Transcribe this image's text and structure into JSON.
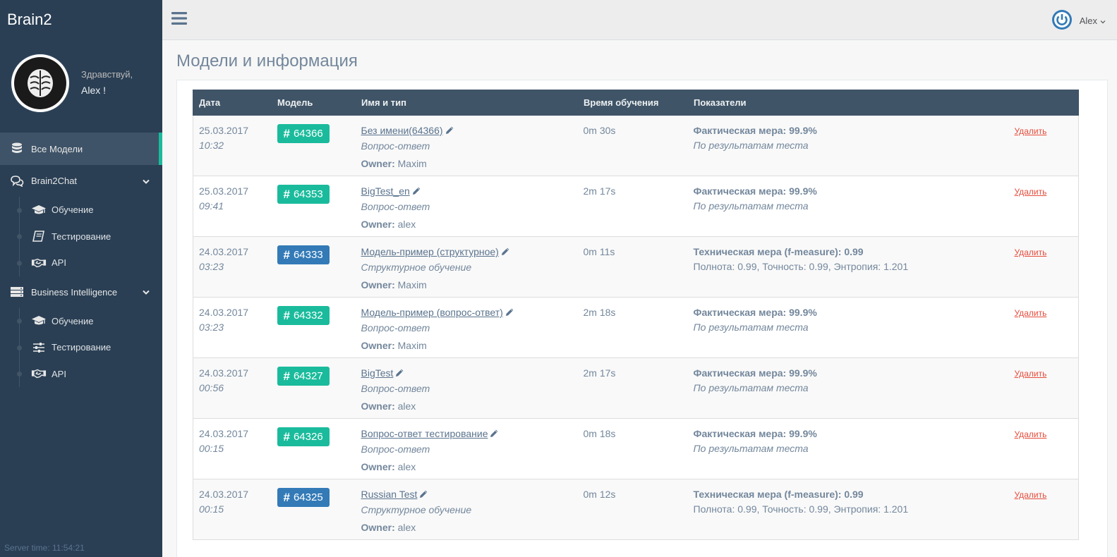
{
  "app": {
    "brand": "Brain2",
    "server_time": "Server time: 11:54:21"
  },
  "profile": {
    "greeting": "Здравствуй,",
    "name": "Alex !"
  },
  "sidebar": {
    "all_models": "Все Модели",
    "brain2chat": {
      "label": "Brain2Chat",
      "items": [
        {
          "label": "Обучение",
          "icon": "graduation-cap-icon"
        },
        {
          "label": "Тестирование",
          "icon": "book-icon"
        },
        {
          "label": "API",
          "icon": "handshake-icon"
        }
      ]
    },
    "bi": {
      "label": "Business Intelligence",
      "items": [
        {
          "label": "Обучение",
          "icon": "graduation-cap-icon"
        },
        {
          "label": "Тестирование",
          "icon": "sliders-icon"
        },
        {
          "label": "API",
          "icon": "handshake-icon"
        }
      ]
    }
  },
  "topnav": {
    "user": "Alex"
  },
  "main": {
    "title": "Модели и информация"
  },
  "table": {
    "headers": [
      "Дата",
      "Модель",
      "Имя и тип",
      "Время обучения",
      "Показатели",
      ""
    ],
    "owner_label": "Owner:",
    "delete_label": "Удалить",
    "rows": [
      {
        "date": "25.03.2017",
        "time": "10:32",
        "id": "64366",
        "badge": "green",
        "name": "Без имени(64366)",
        "type": "Вопрос-ответ",
        "owner": "Maxim",
        "duration": "0m 30s",
        "metric": "Фактическая мера: 99.9%",
        "metric_sub": "По результатам теста",
        "sub_italic": true
      },
      {
        "date": "25.03.2017",
        "time": "09:41",
        "id": "64353",
        "badge": "green",
        "name": "BigTest_en",
        "type": "Вопрос-ответ",
        "owner": "alex",
        "duration": "2m 17s",
        "metric": "Фактическая мера: 99.9%",
        "metric_sub": "По результатам теста",
        "sub_italic": true
      },
      {
        "date": "24.03.2017",
        "time": "03:23",
        "id": "64333",
        "badge": "blue",
        "name": "Модель-пример (структурное)",
        "type": "Структурное обучение",
        "owner": "Maxim",
        "duration": "0m 11s",
        "metric": "Техническая мера (f-measure): 0.99",
        "metric_sub": "Полнота: 0.99, Точность: 0.99, Энтропия: 1.201",
        "sub_italic": false
      },
      {
        "date": "24.03.2017",
        "time": "03:23",
        "id": "64332",
        "badge": "green",
        "name": "Модель-пример (вопрос-ответ)",
        "type": "Вопрос-ответ",
        "owner": "Maxim",
        "duration": "2m 18s",
        "metric": "Фактическая мера: 99.9%",
        "metric_sub": "По результатам теста",
        "sub_italic": true
      },
      {
        "date": "24.03.2017",
        "time": "00:56",
        "id": "64327",
        "badge": "green",
        "name": "BigTest",
        "type": "Вопрос-ответ",
        "owner": "alex",
        "duration": "2m 17s",
        "metric": "Фактическая мера: 99.9%",
        "metric_sub": "По результатам теста",
        "sub_italic": true
      },
      {
        "date": "24.03.2017",
        "time": "00:15",
        "id": "64326",
        "badge": "green",
        "name": "Вопрос-ответ тестирование",
        "type": "Вопрос-ответ",
        "owner": "alex",
        "duration": "0m 18s",
        "metric": "Фактическая мера: 99.9%",
        "metric_sub": "По результатам теста",
        "sub_italic": true
      },
      {
        "date": "24.03.2017",
        "time": "00:15",
        "id": "64325",
        "badge": "blue",
        "name": "Russian Test",
        "type": "Структурное обучение",
        "owner": "alex",
        "duration": "0m 12s",
        "metric": "Техническая мера (f-measure): 0.99",
        "metric_sub": "Полнота: 0.99, Точность: 0.99, Энтропия: 1.201",
        "sub_italic": false
      }
    ]
  },
  "colors": {
    "sidebar": "#2A3F54",
    "accent_green": "#1ABB9C",
    "accent_blue": "#337AB7",
    "danger": "#E74C3C",
    "table_header": "#405467"
  }
}
